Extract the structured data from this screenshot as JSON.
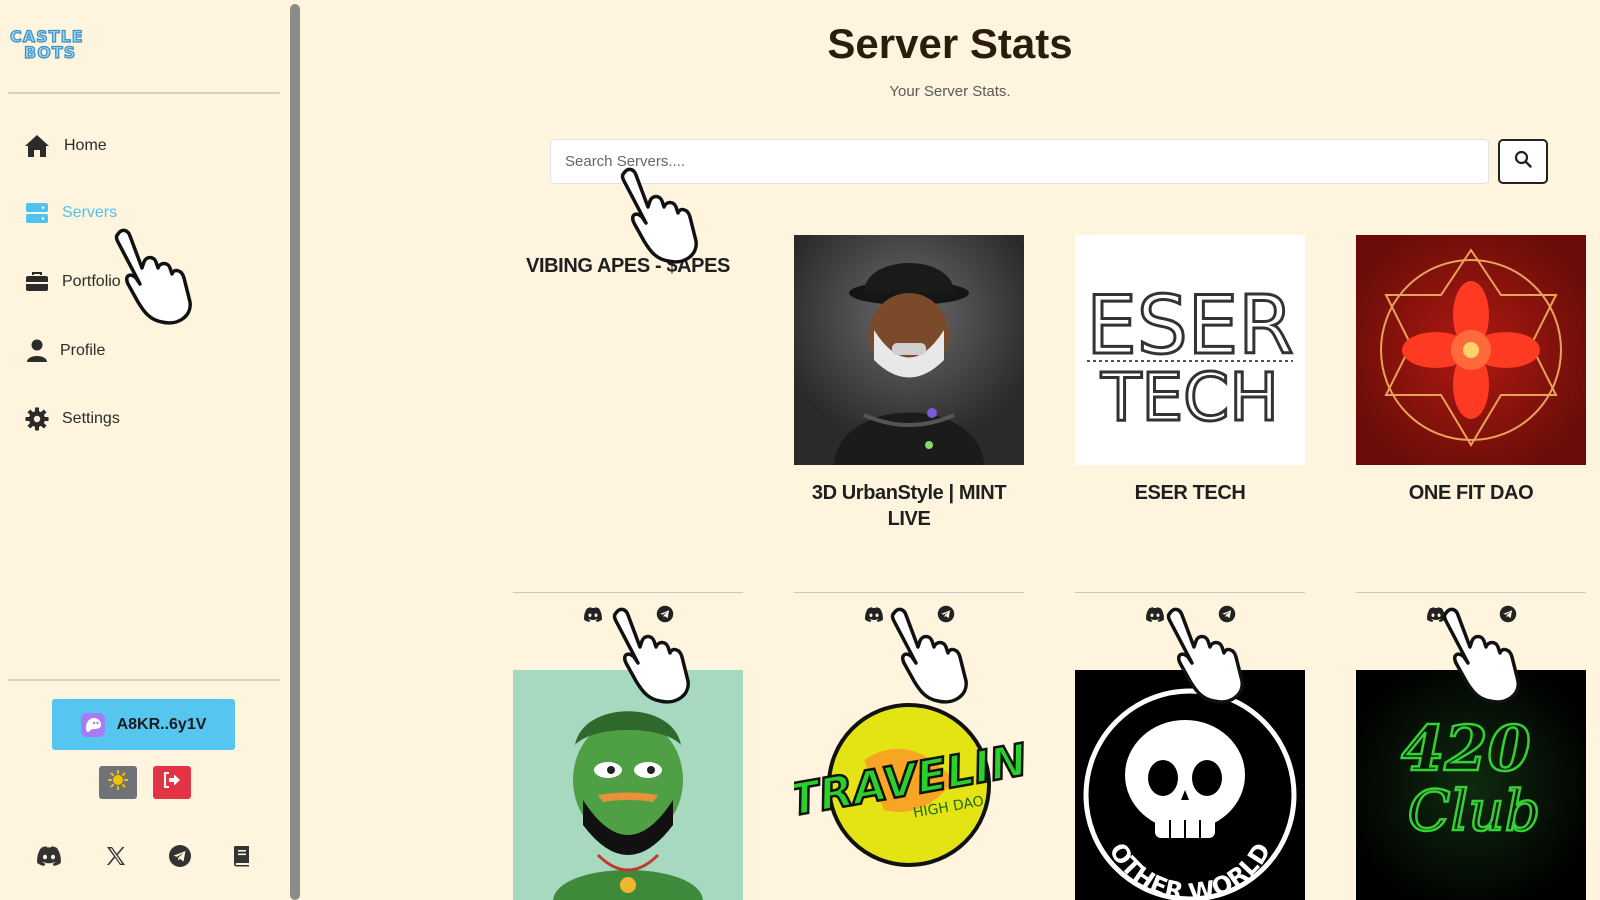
{
  "brand": {
    "logo_text": "CASTLE BOTS"
  },
  "sidebar": {
    "items": [
      {
        "label": "Home",
        "icon": "home-icon",
        "active": false
      },
      {
        "label": "Servers",
        "icon": "servers-icon",
        "active": true
      },
      {
        "label": "Portfolio",
        "icon": "briefcase-icon",
        "active": false
      },
      {
        "label": "Profile",
        "icon": "user-icon",
        "active": false
      },
      {
        "label": "Settings",
        "icon": "gear-icon",
        "active": false
      }
    ],
    "wallet_label": "A8KR..6y1V",
    "wallet_icon": "phantom-icon",
    "theme_icon": "sun-icon",
    "logout_icon": "logout-icon",
    "socials": [
      "discord-icon",
      "x-icon",
      "telegram-icon",
      "docs-icon"
    ]
  },
  "page": {
    "title": "Server Stats",
    "subtitle": "Your Server Stats."
  },
  "search": {
    "placeholder": "Search Servers....",
    "value": "",
    "button_icon": "search-icon"
  },
  "servers": [
    {
      "name": "VIBING APES - $APES",
      "image": "none"
    },
    {
      "name": "3D UrbanStyle | MINT LIVE",
      "image": "hooded-figure"
    },
    {
      "name": "ESER TECH",
      "image": "eser-tech-logo"
    },
    {
      "name": "ONE FIT DAO",
      "image": "red-mandala"
    }
  ],
  "servers_row2": [
    {
      "image": "green-pepe"
    },
    {
      "image": "travelin-logo"
    },
    {
      "image": "other-world-skull"
    },
    {
      "image": "neon-420-club"
    }
  ],
  "images": {
    "travelin_text": "TRAVELIN",
    "travelin_sub": "HIGH DAO",
    "otherworld_text": "OTHER WORLD",
    "eser_line1": "ESER",
    "eser_line2": "TECH",
    "club_line1": "420",
    "club_line2": "Club"
  },
  "colors": {
    "background": "#fff4dd",
    "accent": "#55c6f0",
    "logout": "#e33446",
    "active_nav": "#4fc3ef"
  }
}
